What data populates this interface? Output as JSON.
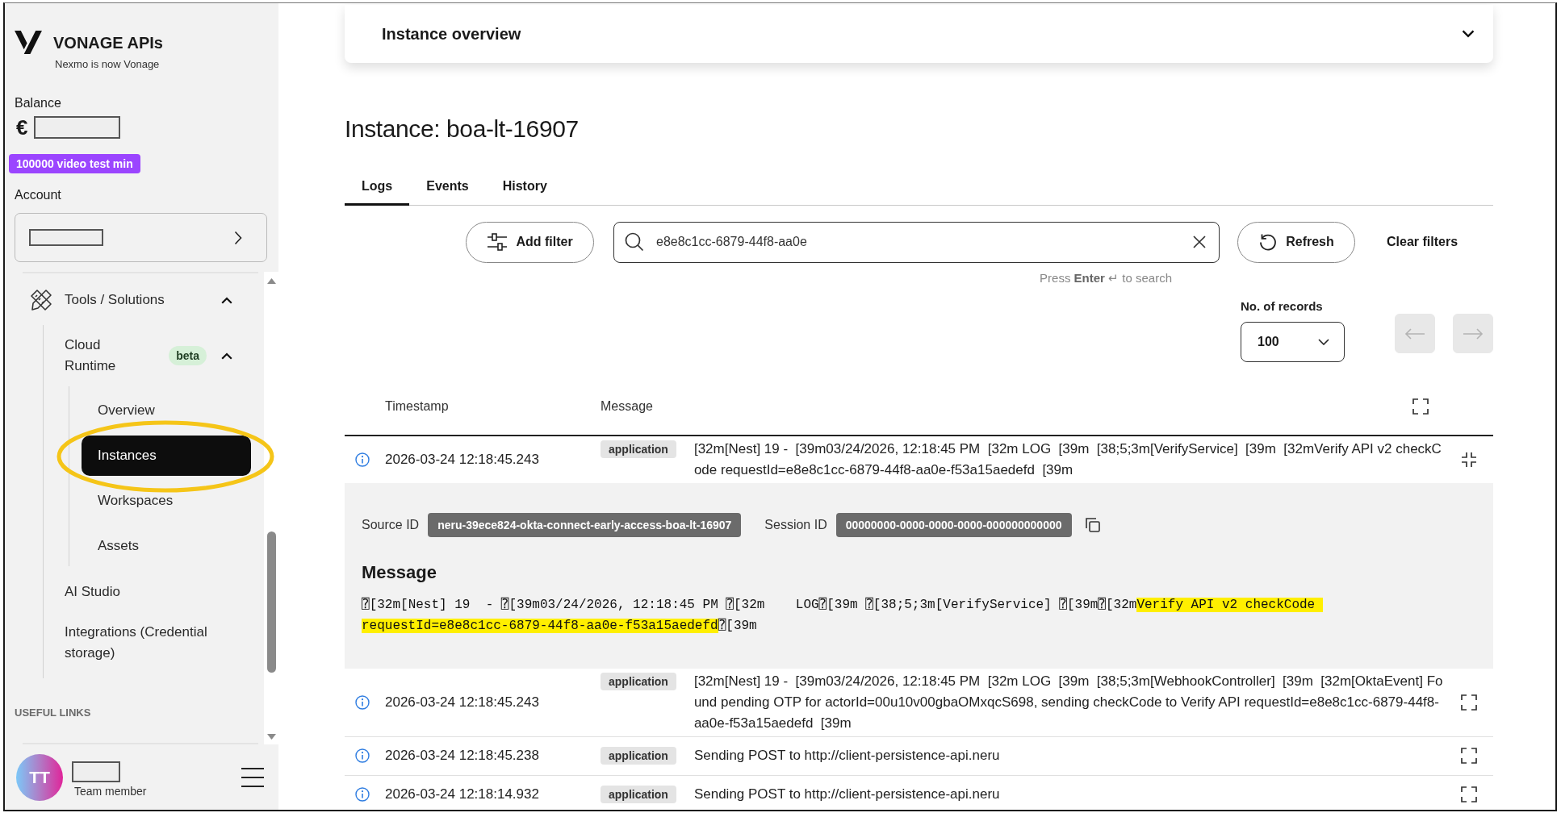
{
  "sidebar": {
    "brand": "VONAGE APIs",
    "tagline": "Nexmo is now Vonage",
    "balance_label": "Balance",
    "currency": "€",
    "promo_badge": "100000 video test min",
    "account_label": "Account",
    "nav": [
      {
        "label": "Tools / Solutions",
        "selected": false,
        "expanded": true,
        "children": [
          {
            "label": "Cloud Runtime",
            "badge": "beta",
            "selected": false,
            "expanded": true,
            "children": [
              {
                "label": "Overview",
                "selected": false
              },
              {
                "label": "Instances",
                "selected": true
              },
              {
                "label": "Workspaces",
                "selected": false
              },
              {
                "label": "Assets",
                "selected": false
              }
            ]
          },
          {
            "label": "AI Studio",
            "selected": false
          },
          {
            "label": "Integrations (Credential storage)",
            "selected": false
          }
        ]
      }
    ],
    "section_heading": "USEFUL LINKS",
    "user": {
      "initials": "TT",
      "role": "Team member"
    }
  },
  "header_card": {
    "title": "Instance overview",
    "expanded": false
  },
  "page_title": "Instance: boa-lt-16907",
  "tabs": [
    {
      "label": "Logs",
      "selected": true
    },
    {
      "label": "Events",
      "selected": false
    },
    {
      "label": "History",
      "selected": false
    }
  ],
  "filters": {
    "add_filter": "Add filter",
    "search": {
      "value": "e8e8c1cc-6879-44f8-aa0e"
    },
    "hint": "Press **Enter** ↵ to search",
    "refresh": "Refresh",
    "clear": "Clear filters"
  },
  "records": {
    "label": "No. of records",
    "value": "100"
  },
  "pagination": [
    {
      "kind": "previous",
      "disabled": true
    },
    {
      "kind": "next",
      "disabled": true
    }
  ],
  "table": {
    "columns": [
      "Timestamp",
      "Message"
    ],
    "rows": [
      {
        "timestamp": "2026-03-24 12:18:45.243",
        "source": "application",
        "message": "[32m[Nest] 19 -  [39m03/24/2026, 12:18:45 PM  [32m LOG  [39m  [38;5;3m[VerifyService]  [39m  [32mVerify API v2 checkCode requestId=e8e8c1cc-6879-44f8-aa0e-f53a15aedefd  [39m",
        "expanded": true,
        "details": {
          "fields": [
            {
              "label": "Source ID",
              "value": "neru-39ece824-okta-connect-early-access-boa-lt-16907",
              "copyable": false
            },
            {
              "label": "Session ID",
              "value": "00000000-0000-0000-0000-000000000000",
              "copyable": true
            }
          ],
          "heading": "Message",
          "segments": [
            {
              "text": "⍰[32m[Nest] 19  - ⍰[39m03/24/2026, 12:18:45 PM ⍰[32m    LOG⍰[39m ⍰[38;5;3m[VerifyService] ⍰[39m⍰[32m",
              "highlighted": false
            },
            {
              "text": "Verify API v2 checkCode ",
              "highlighted": true
            },
            {
              "text": "requestId=e8e8c1cc-6879-44f8-aa0e-f53a15aedefd",
              "highlighted": true
            },
            {
              "text": "⍰[39m",
              "highlighted": false
            }
          ]
        }
      },
      {
        "timestamp": "2026-03-24 12:18:45.243",
        "source": "application",
        "message": "[32m[Nest] 19 -  [39m03/24/2026, 12:18:45 PM  [32m LOG  [39m  [38;5;3m[WebhookController]  [39m  [32m[OktaEvent] Found pending OTP for actorId=00u10v00gbaOMxqcS698, sending checkCode to Verify API requestId=e8e8c1cc-6879-44f8-aa0e-f53a15aedefd  [39m",
        "expanded": false
      },
      {
        "timestamp": "2026-03-24 12:18:45.238",
        "source": "application",
        "message": "Sending POST to http://client-persistence-api.neru",
        "expanded": false
      },
      {
        "timestamp": "2026-03-24 12:18:14.932",
        "source": "application",
        "message": "Sending POST to http://client-persistence-api.neru",
        "expanded": false
      }
    ]
  }
}
